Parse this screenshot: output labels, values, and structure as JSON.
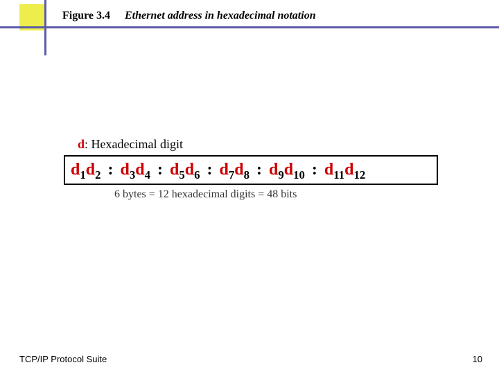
{
  "header": {
    "figure_label": "Figure 3.4",
    "figure_title": "Ethernet address in hexadecimal notation"
  },
  "legend": {
    "symbol": "d",
    "text": ": Hexadecimal digit"
  },
  "address": {
    "d": "d",
    "subs": [
      "1",
      "2",
      "3",
      "4",
      "5",
      "6",
      "7",
      "8",
      "9",
      "10",
      "11",
      "12"
    ],
    "sep": ":"
  },
  "caption": "6 bytes = 12 hexadecimal digits = 48 bits",
  "footer": {
    "left": "TCP/IP Protocol Suite",
    "page": "10"
  }
}
